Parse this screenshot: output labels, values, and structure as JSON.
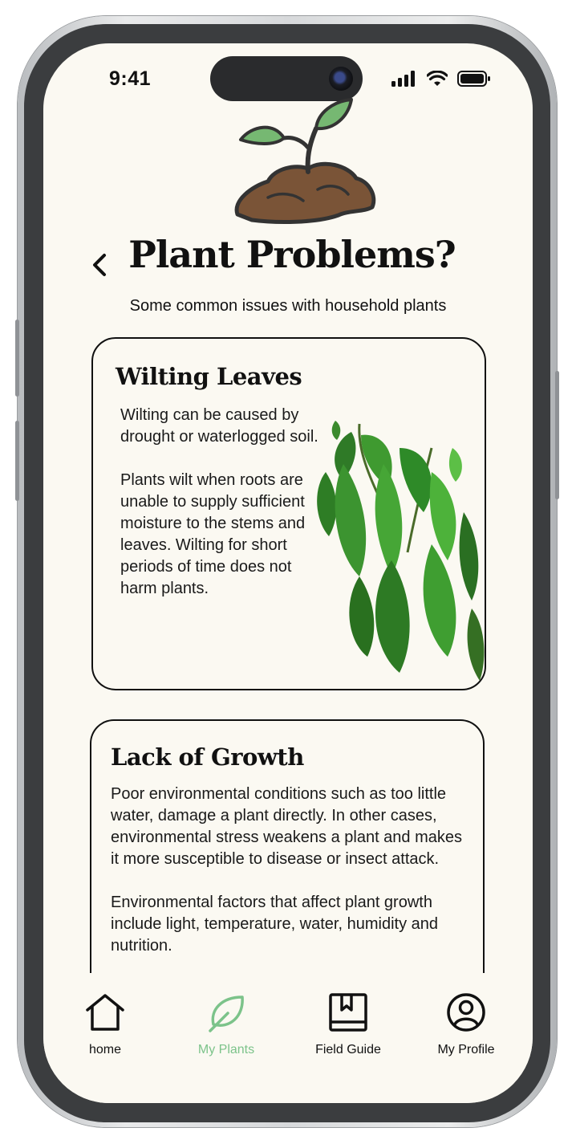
{
  "status_bar": {
    "time": "9:41"
  },
  "header": {
    "title": "Plant Problems?",
    "subtitle": "Some common issues with household plants"
  },
  "cards": [
    {
      "title": "Wilting Leaves",
      "body": "Wilting can be caused by drought or waterlogged soil.\n\nPlants wilt when roots are unable to supply sufficient moisture to the stems and leaves. Wilting for short periods of time does not harm plants."
    },
    {
      "title": "Lack of Growth",
      "body": "Poor environmental conditions such as too little water, damage a plant directly. In other cases, environmental stress weakens a plant and makes it more susceptible to disease or insect attack.\n\nEnvironmental factors that affect plant growth include light, temperature, water, humidity and nutrition."
    }
  ],
  "nav": {
    "items": [
      {
        "label": "home",
        "icon": "home-icon"
      },
      {
        "label": "My Plants",
        "icon": "leaf-icon",
        "active": true
      },
      {
        "label": "Field Guide",
        "icon": "book-icon"
      },
      {
        "label": "My Profile",
        "icon": "profile-icon"
      }
    ]
  },
  "colors": {
    "background": "#fbf9f2",
    "accent": "#7cc38a",
    "text": "#111111"
  }
}
